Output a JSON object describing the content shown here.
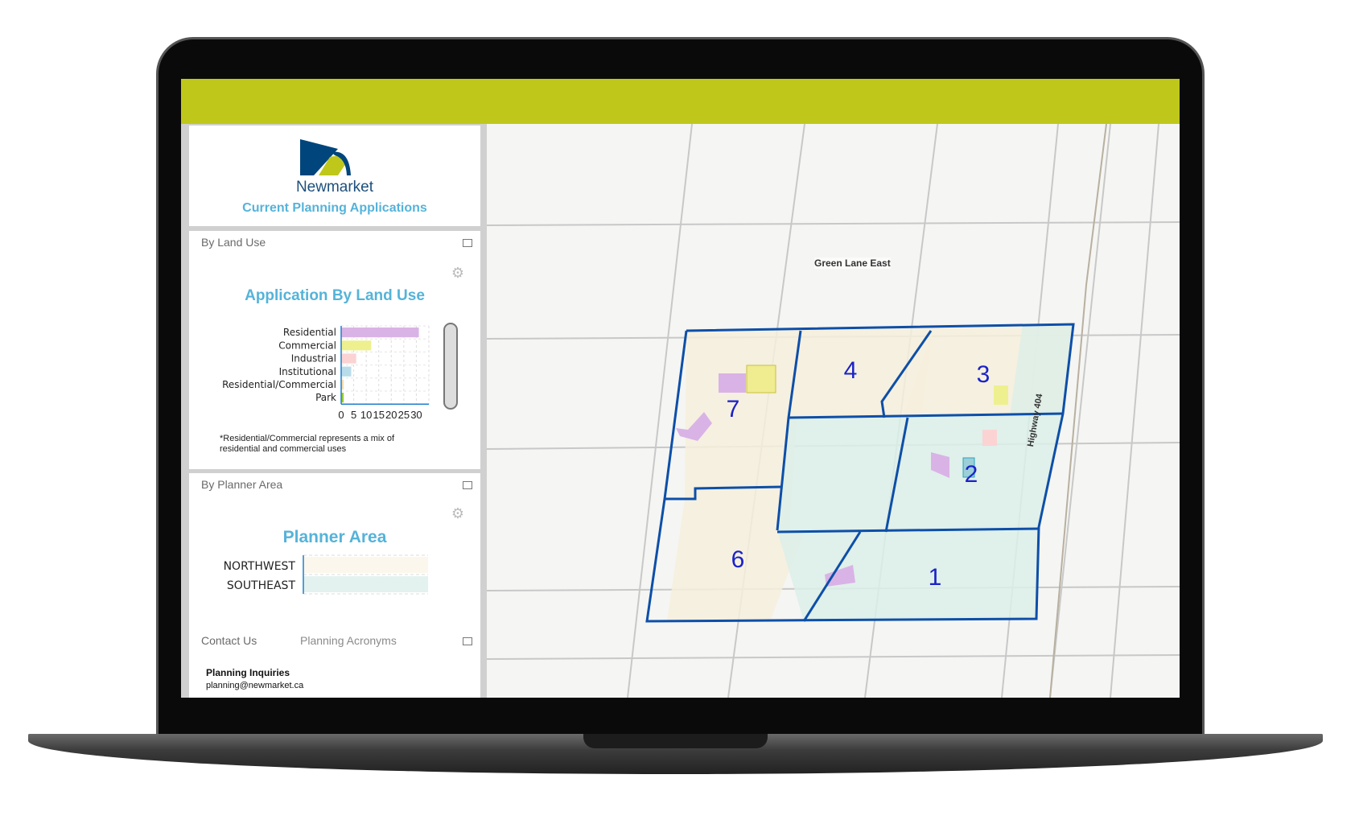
{
  "header": {
    "org_name": "Newmarket",
    "app_title": "Current Planning Applications",
    "accent_color": "#bfc81a",
    "title_color": "#55b3d9"
  },
  "land_use_panel": {
    "tab_label": "By Land Use",
    "footnote": "*Residential/Commercial represents a mix of residential and commercial uses"
  },
  "planner_panel": {
    "tab_label": "By Planner Area"
  },
  "contact_panel": {
    "tabs": [
      "Contact Us",
      "Planning Acronyms"
    ],
    "heading": "Planning Inquiries",
    "email": "planning@newmarket.ca"
  },
  "chart_data": [
    {
      "type": "bar",
      "orientation": "horizontal",
      "title": "Application By Land Use",
      "categories": [
        "Residential",
        "Commercial",
        "Industrial",
        "Institutional",
        "Residential/Commercial",
        "Park"
      ],
      "values": [
        31,
        12,
        6,
        4,
        1,
        1
      ],
      "colors": [
        "#d9b3e6",
        "#eef08f",
        "#fbd3d3",
        "#b8dcea",
        "#f5deb3",
        "#9acd32"
      ],
      "xticks": [
        0,
        5,
        10,
        15,
        20,
        25,
        30
      ],
      "xlim": [
        0,
        35
      ],
      "grid": true
    },
    {
      "type": "bar",
      "orientation": "horizontal",
      "title": "Planner Area",
      "categories": [
        "NORTHWEST",
        "SOUTHEAST"
      ],
      "colors": [
        "#fbf7ec",
        "#e3f2ef"
      ],
      "grid": true
    }
  ],
  "map": {
    "road_label": "Green Lane East",
    "highway_label": "Highway 404",
    "districts": [
      "1",
      "2",
      "3",
      "4",
      "6",
      "7"
    ],
    "boundary_color": "#0d4fa8"
  }
}
